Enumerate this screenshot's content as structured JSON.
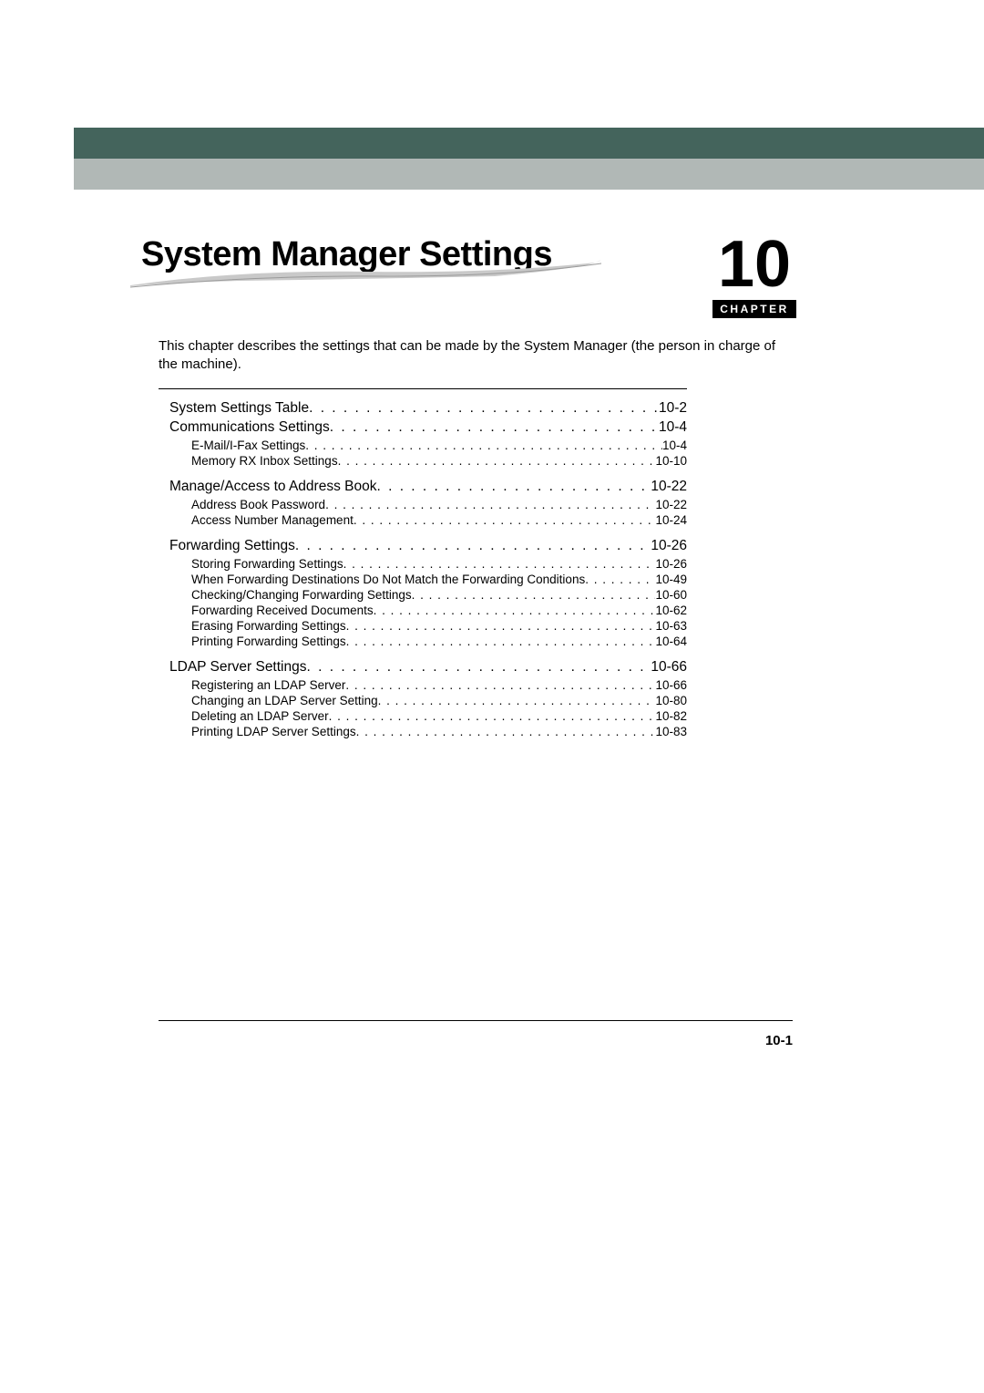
{
  "page": {
    "chapter_number": "10",
    "chapter_label": "CHAPTER",
    "title": "System Manager Settings",
    "intro": "This chapter describes the settings that can be made by the System Manager (the person in charge of the machine).",
    "page_number": "10-1"
  },
  "toc": [
    {
      "level": 1,
      "label": "System Settings Table ",
      "page": "10-2"
    },
    {
      "level": 1,
      "label": "Communications Settings",
      "page": "10-4"
    },
    {
      "level": 2,
      "label": "E-Mail/I-Fax Settings",
      "page": "10-4"
    },
    {
      "level": 2,
      "label": "Memory RX Inbox Settings",
      "page": "10-10"
    },
    {
      "gap": true
    },
    {
      "level": 1,
      "label": "Manage/Access to Address Book",
      "page": "10-22"
    },
    {
      "level": 2,
      "label": "Address Book Password ",
      "page": "10-22"
    },
    {
      "level": 2,
      "label": "Access Number Management ",
      "page": "10-24"
    },
    {
      "gap": true
    },
    {
      "level": 1,
      "label": "Forwarding Settings ",
      "page": "10-26"
    },
    {
      "level": 2,
      "label": "Storing Forwarding Settings",
      "page": "10-26"
    },
    {
      "level": 2,
      "label": "When Forwarding Destinations Do Not Match the Forwarding Conditions ",
      "page": "10-49"
    },
    {
      "level": 2,
      "label": "Checking/Changing Forwarding Settings ",
      "page": "10-60"
    },
    {
      "level": 2,
      "label": "Forwarding Received Documents ",
      "page": "10-62"
    },
    {
      "level": 2,
      "label": "Erasing Forwarding Settings ",
      "page": "10-63"
    },
    {
      "level": 2,
      "label": "Printing Forwarding Settings ",
      "page": "10-64"
    },
    {
      "gap": true
    },
    {
      "level": 1,
      "label": "LDAP Server Settings",
      "page": "10-66"
    },
    {
      "level": 2,
      "label": "Registering an LDAP Server",
      "page": "10-66"
    },
    {
      "level": 2,
      "label": "Changing an LDAP Server Setting",
      "page": "10-80"
    },
    {
      "level": 2,
      "label": "Deleting an LDAP Server ",
      "page": "10-82"
    },
    {
      "level": 2,
      "label": "Printing LDAP Server Settings ",
      "page": "10-83"
    }
  ]
}
